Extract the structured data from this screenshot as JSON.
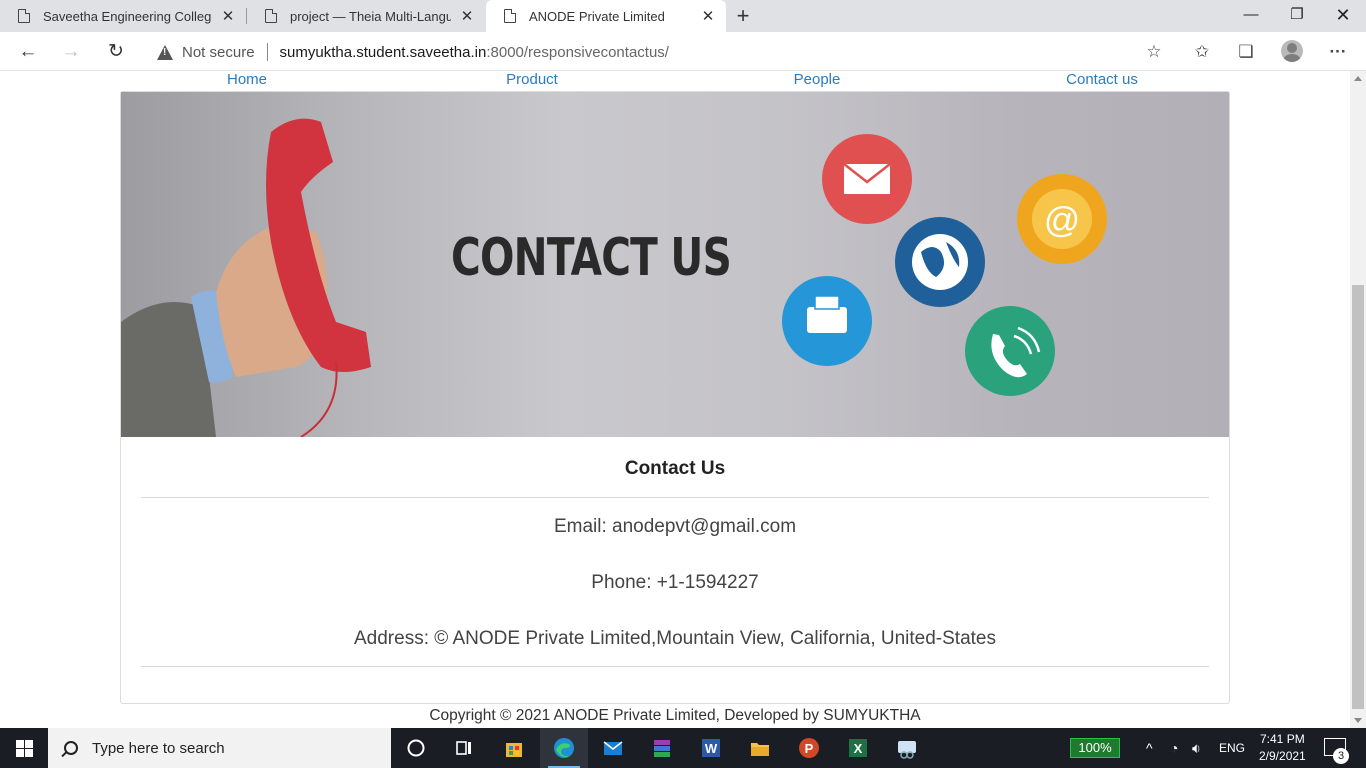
{
  "tabs": [
    {
      "title": "Saveetha Engineering College",
      "active": false
    },
    {
      "title": "project — Theia Multi-Language",
      "active": false
    },
    {
      "title": "ANODE Private Limited",
      "active": true
    }
  ],
  "addressbar": {
    "security_label": "Not secure",
    "url_host": "sumyuktha.student.saveetha.in",
    "url_rest": ":8000/responsivecontactus/"
  },
  "nav": {
    "home": "Home",
    "product": "Product",
    "people": "People",
    "contact": "Contact us"
  },
  "banner": {
    "title": "CONTACT US"
  },
  "contact": {
    "heading": "Contact Us",
    "email": "Email: anodepvt@gmail.com",
    "phone": "Phone: +1-1594227",
    "address": "Address: © ANODE Private Limited,Mountain View, California, United-States"
  },
  "footer": {
    "copyright": "Copyright © 2021 ANODE Private Limited, Developed by SUMYUKTHA"
  },
  "taskbar": {
    "search_placeholder": "Type here to search",
    "battery": "100%",
    "language": "ENG",
    "time": "7:41 PM",
    "date": "2/9/2021",
    "notification_count": "3"
  }
}
